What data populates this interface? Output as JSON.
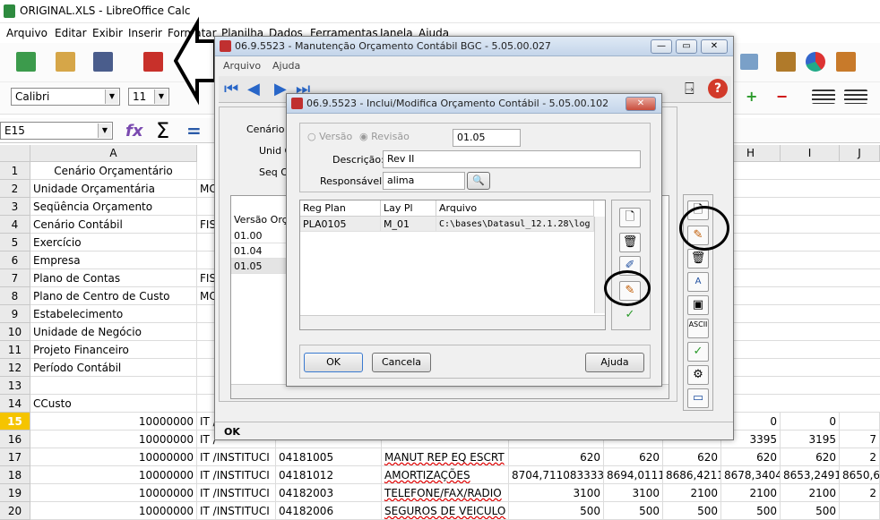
{
  "calc": {
    "title": "ORIGINAL.XLS - LibreOffice Calc",
    "menu": [
      "Arquivo",
      "Editar",
      "Exibir",
      "Inserir",
      "Formatar",
      "Planilha",
      "Dados",
      "Ferramentas",
      "Janela",
      "Ajuda"
    ],
    "font_name": "Calibri",
    "font_size": "11",
    "cell_ref": "E15",
    "columns": [
      "A",
      "H",
      "I",
      "J"
    ],
    "rows": [
      {
        "n": "1",
        "a": "Cenário Orçamentário",
        "b": ""
      },
      {
        "n": "2",
        "a": "Unidade Orçamentária",
        "b": "MC"
      },
      {
        "n": "3",
        "a": "Seqüência Orçamento",
        "b": ""
      },
      {
        "n": "4",
        "a": "Cenário Contábil",
        "b": "FIS"
      },
      {
        "n": "5",
        "a": "Exercício",
        "b": ""
      },
      {
        "n": "6",
        "a": "Empresa",
        "b": ""
      },
      {
        "n": "7",
        "a": "Plano de Contas",
        "b": "FIS"
      },
      {
        "n": "8",
        "a": "Plano de Centro de Custo",
        "b": "MC"
      },
      {
        "n": "9",
        "a": "Estabelecimento",
        "b": ""
      },
      {
        "n": "10",
        "a": "Unidade de Negócio",
        "b": ""
      },
      {
        "n": "11",
        "a": "Projeto Financeiro",
        "b": ""
      },
      {
        "n": "12",
        "a": "Período Contábil",
        "b": ""
      },
      {
        "n": "13",
        "a": "",
        "b": ""
      },
      {
        "n": "14",
        "a": "CCusto",
        "b": ""
      }
    ],
    "data_rows": [
      {
        "n": "15",
        "a": "10000000",
        "b": "IT /",
        "c": "",
        "d": "",
        "e": "",
        "f": "",
        "g": "",
        "h": "0",
        "i": "0",
        "j": ""
      },
      {
        "n": "16",
        "a": "10000000",
        "b": "IT /",
        "c": "",
        "d": "",
        "e": "",
        "f": "",
        "g": "",
        "h": "3395",
        "i": "3195",
        "j": "7"
      },
      {
        "n": "17",
        "a": "10000000",
        "b": "IT /INSTITUCI",
        "c": "04181005",
        "d": "MANUT REP EQ ESCRT",
        "e": "620",
        "f": "620",
        "g": "620",
        "h": "620",
        "i": "620",
        "j": "2"
      },
      {
        "n": "18",
        "a": "10000000",
        "b": "IT /INSTITUCI",
        "c": "04181012",
        "d": "AMORTIZAÇÕES",
        "e": "8704,711083333",
        "f": "8694,0111",
        "g": "8686,4211",
        "h": "8678,3404",
        "i": "8653,2491",
        "j": "8650,6"
      },
      {
        "n": "19",
        "a": "10000000",
        "b": "IT /INSTITUCI",
        "c": "04182003",
        "d": "TELEFONE/FAX/RADIO",
        "e": "3100",
        "f": "3100",
        "g": "2100",
        "h": "2100",
        "i": "2100",
        "j": "2"
      },
      {
        "n": "20",
        "a": "10000000",
        "b": "IT /INSTITUCI",
        "c": "04182006",
        "d": "SEGUROS DE VEICULO",
        "e": "500",
        "f": "500",
        "g": "500",
        "h": "500",
        "i": "500",
        "j": ""
      }
    ]
  },
  "outer": {
    "title": "06.9.5523 - Manutenção Orçamento Contábil BGC - 5.05.00.027",
    "menu": [
      "Arquivo",
      "Ajuda"
    ],
    "labels": [
      "Cenário C",
      "Unid O",
      "Seq Or"
    ],
    "grid_header": "Versão Orça",
    "versions": [
      "01.00",
      "01.04",
      "01.05"
    ],
    "status": "OK"
  },
  "inner": {
    "title": "06.9.5523 - Inclui/Modifica Orçamento Contábil - 5.05.00.102",
    "radio_versao": "Versão",
    "radio_revisao": "Revisão",
    "version_value": "01.05",
    "descricao_label": "Descrição:",
    "descricao_value": "Rev II",
    "responsavel_label": "Responsável:",
    "responsavel_value": "alima",
    "grid_headers": [
      "Reg Plan",
      "Lay Pl Orcto",
      "Arquivo"
    ],
    "grid_row": [
      "PLA0105",
      "M_01",
      "C:\\bases\\Datasul_12.1.28\\log"
    ],
    "ok_label": "OK",
    "cancel_label": "Cancela",
    "help_label": "Ajuda"
  }
}
